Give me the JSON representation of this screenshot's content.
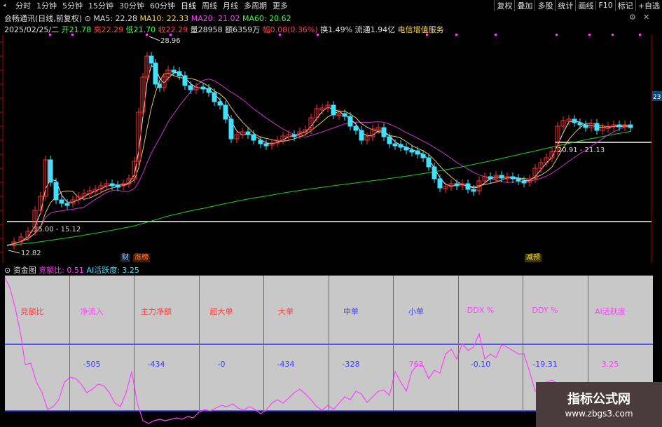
{
  "tabs": [
    "分时",
    "1分钟",
    "5分钟",
    "15分钟",
    "30分钟",
    "60分钟",
    "日线",
    "周线",
    "月线",
    "多周期",
    "更多"
  ],
  "active_tab": "日线",
  "right_buttons": [
    "复权",
    "叠加",
    "多股",
    "统计",
    "画线",
    "F10",
    "标记",
    "+自选"
  ],
  "title_line": {
    "name": "会畅通讯(日线,前复权)",
    "ma5": "MA5: 22.28",
    "ma10": "MA10: 22.33",
    "ma20": "MA20: 21.02",
    "ma60": "MA60: 20.62"
  },
  "quote_line": {
    "date": "2025/02/25/二",
    "open": "开21.78",
    "high": "高22.29",
    "low": "低21.70",
    "close": "收22.29",
    "volume": "量28958",
    "amount": "额6359万",
    "change": "幅0.08(0.36%)",
    "turnover": "换1.49%",
    "float": "流通1.94亿",
    "sector": "电信增值服务"
  },
  "annotations": {
    "high_label": "28.96",
    "low_label": "12.82",
    "range1": "15.00 - 15.12",
    "range2": "20.91 - 21.13",
    "axis_right": "23"
  },
  "badges": {
    "cai": "财",
    "zhangbang": "涨榜",
    "jianchi": "减预"
  },
  "sub_panel": {
    "title": "资金图",
    "indicator1": "竞额比: 0.51",
    "indicator2": "AI活跃度: 3.25",
    "headers": [
      "竞额比",
      "净流入",
      "主力净额",
      "超大单",
      "大单",
      "中单",
      "小单",
      "DDX %",
      "DDY %",
      "AI活跃度"
    ],
    "values": [
      "",
      "-505",
      "-434",
      "-0",
      "-434",
      "-328",
      "763",
      "-0.10",
      "-19.31",
      "3.25"
    ]
  },
  "watermark": {
    "line1": "指标公式网",
    "line2": "www.zbgs3.com"
  }
}
